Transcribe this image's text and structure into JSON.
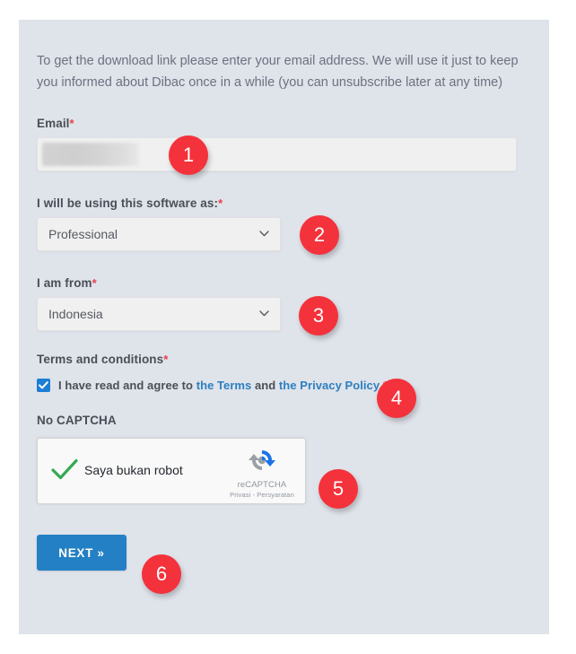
{
  "form": {
    "intro": "To get the download link please enter your email address. We will use it just to keep you informed about Dibac once in a while (you can unsubscribe later at any time)",
    "email": {
      "label": "Email",
      "required_mark": "*",
      "value": "",
      "placeholder": ""
    },
    "usage": {
      "label": "I will be using this software as:",
      "required_mark": "*",
      "selected": "Professional"
    },
    "country": {
      "label": "I am from",
      "required_mark": "*",
      "selected": "Indonesia"
    },
    "terms": {
      "label": "Terms and conditions",
      "required_mark": "*",
      "checked": true,
      "text_before": "I have read and agree to ",
      "terms_link": "the Terms",
      "text_middle": " and ",
      "privacy_link": "the Privacy Policy",
      "text_after": " *"
    },
    "captcha": {
      "heading": "No CAPTCHA",
      "checkbox_label": "Saya bukan robot",
      "brand": "reCAPTCHA",
      "legal": "Privasi - Persyaratan",
      "verified": true
    },
    "next_button": "NEXT »"
  },
  "annotations": [
    {
      "number": "1"
    },
    {
      "number": "2"
    },
    {
      "number": "3"
    },
    {
      "number": "4"
    },
    {
      "number": "5"
    },
    {
      "number": "6"
    }
  ],
  "colors": {
    "panel_bg": "#dfe3ea",
    "badge": "#f4323c",
    "primary_button": "#2480c4",
    "link": "#2d7fc0",
    "checkbox": "#1d7fd4",
    "required": "#e8404a",
    "captcha_check": "#34a853"
  }
}
